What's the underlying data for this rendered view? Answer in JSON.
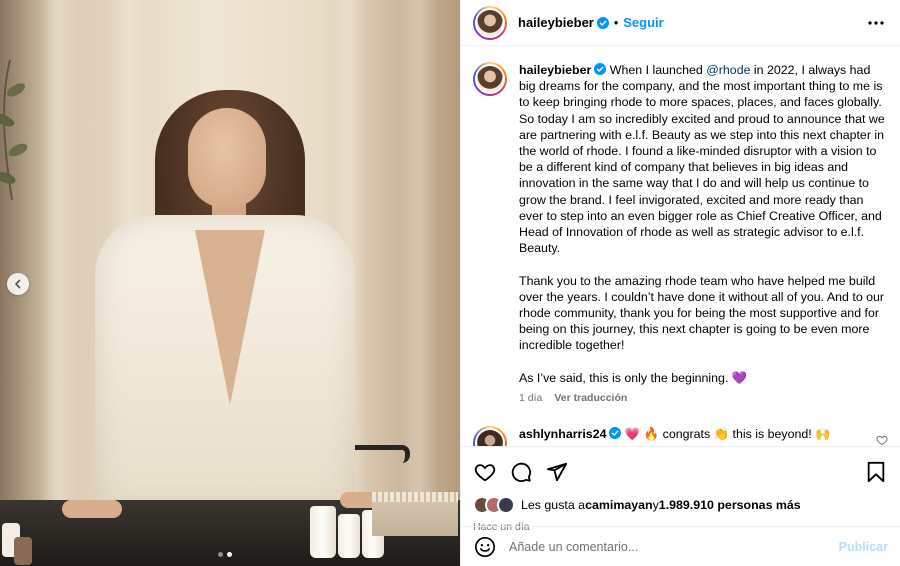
{
  "post": {
    "author": "haileybieber",
    "follow_label": "Seguir",
    "separator": "•",
    "carousel": {
      "total": 2,
      "active": 2
    }
  },
  "caption": {
    "author": "haileybieber",
    "part1": " When I launched ",
    "mention": "@rhode",
    "part2": " in 2022, I always had big dreams for the company, and the most important thing to me is to keep bringing rhode to more spaces, places, and faces globally. So today I am so incredibly excited and proud to announce that we are partnering with e.l.f. Beauty as we step into this next chapter in the world of rhode. I found a like-minded disruptor with a vision to be a different kind of company that believes in big ideas and innovation in the same way that I do and will help us continue to grow the brand. I feel invigorated, excited and more ready than ever to step into an even bigger role as Chief Creative Officer, and Head of Innovation of rhode as well as strategic advisor to e.l.f. Beauty.\n\nThank you to the amazing rhode team who have helped me build over the years. I couldn’t have done it without all of you. And to our rhode community, thank you for being the most supportive and for being on this journey, this next chapter is going to be even more incredible together!\n\nAs I’ve said, this is only the beginning. 💜",
    "age": "1 día",
    "translate_label": "Ver traducción"
  },
  "comments": [
    {
      "author": "ashlynharris24",
      "text": " 💗 🔥 congrats 👏 this is beyond! 🙌"
    }
  ],
  "likes": {
    "prefix": "Les gusta a ",
    "first_user": "camimayan",
    "middle": " y ",
    "count_text": "1.989.910 personas más"
  },
  "timestamp": "Hace un día",
  "add_comment": {
    "placeholder": "Añade un comentario...",
    "post_label": "Publicar"
  },
  "icons": {
    "like": "heart-icon",
    "comment": "comment-icon",
    "share": "share-icon",
    "save": "bookmark-icon",
    "more": "more-icon",
    "emoji": "emoji-icon",
    "prev": "chevron-left-icon"
  },
  "colors": {
    "link": "#0095f6",
    "mention": "#00376b",
    "muted": "#737373",
    "post_disabled": "#b2dffc"
  }
}
